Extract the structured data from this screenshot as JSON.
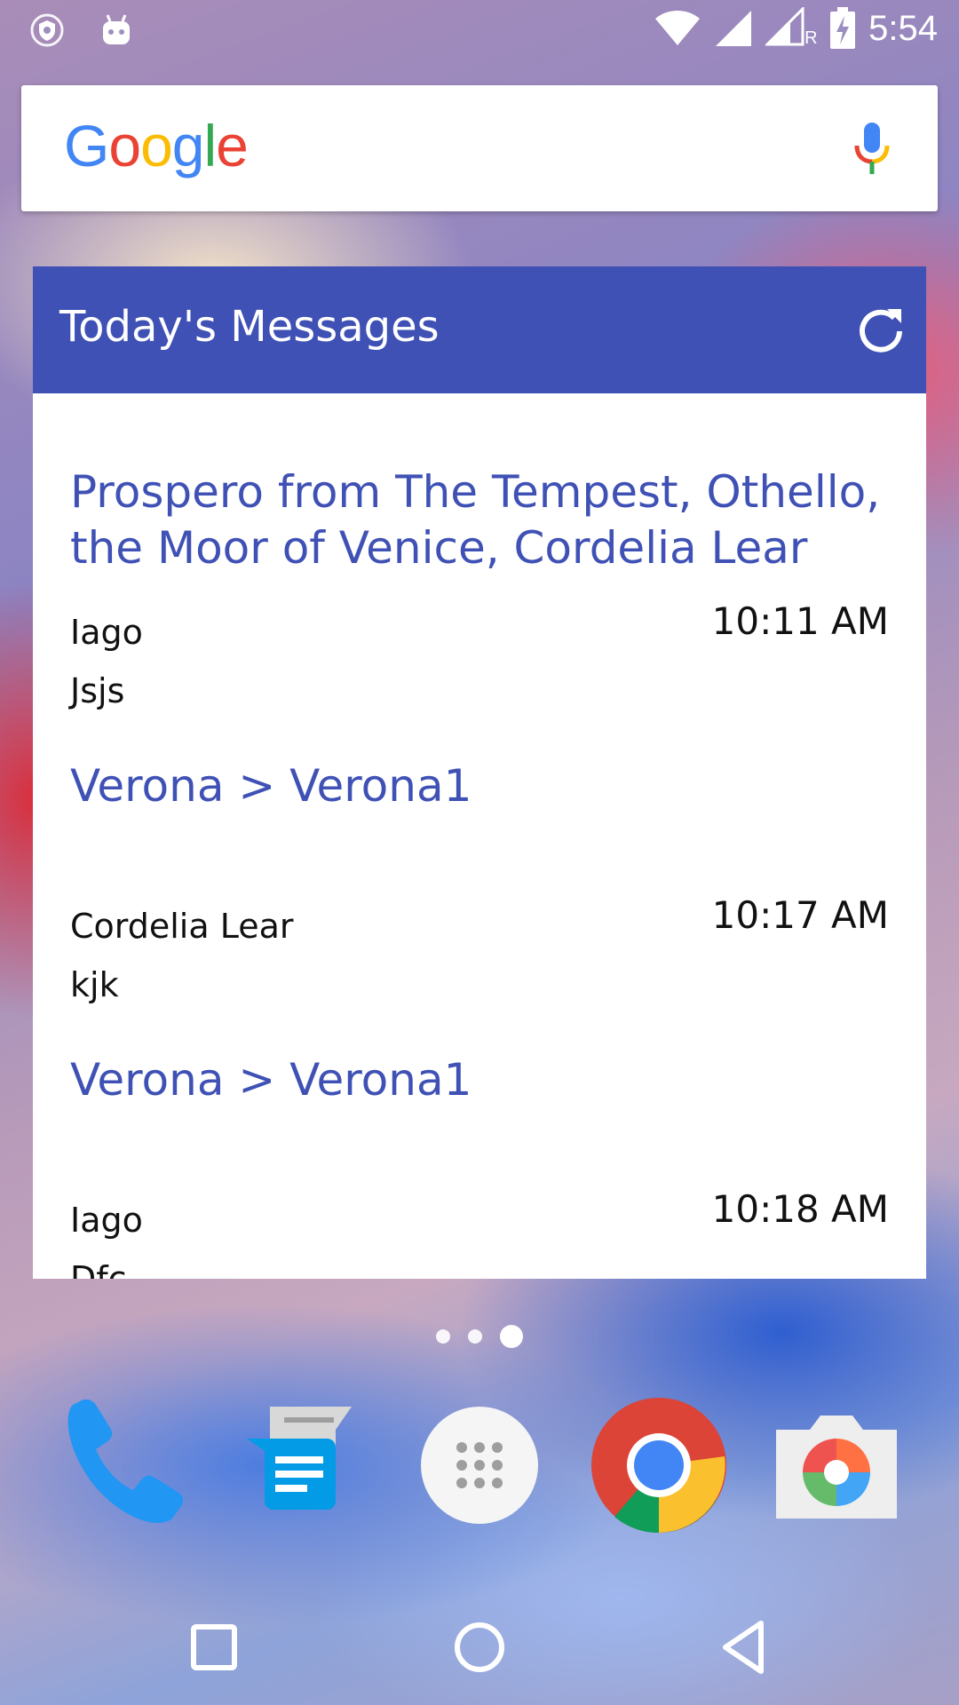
{
  "status_bar": {
    "time": "5:54",
    "icons": [
      "vpn-shield-icon",
      "android-icon",
      "wifi-icon",
      "signal-icon",
      "signal-roaming-icon",
      "battery-charging-icon"
    ],
    "roaming_label": "R"
  },
  "search_bar": {
    "logo_letters": [
      "G",
      "o",
      "o",
      "g",
      "l",
      "e"
    ],
    "logo_colors": [
      "#4285F4",
      "#EA4335",
      "#FBBC05",
      "#4285F4",
      "#34A853",
      "#EA4335"
    ],
    "icon": "mic-icon"
  },
  "widget": {
    "title": "Today's Messages",
    "header_color": "#3f51b5",
    "refresh_icon": "refresh-icon",
    "messages": [
      {
        "title": "Prospero from The Tempest, Othello, the Moor of Venice, Cordelia Lear",
        "sender": "Iago",
        "body": "Jsjs",
        "time": "10:11 AM"
      },
      {
        "title": "Verona > Verona1",
        "sender": "Cordelia Lear",
        "body": "kjk",
        "time": "10:17 AM"
      },
      {
        "title": "Verona > Verona1",
        "sender": "Iago",
        "body": "Dfc",
        "time": "10:18 AM"
      }
    ]
  },
  "page_indicator": {
    "pages": 3,
    "active_index": 2
  },
  "dock": {
    "apps": [
      "phone-app-icon",
      "messages-app-icon",
      "app-drawer-icon",
      "chrome-app-icon",
      "camera-app-icon"
    ]
  },
  "nav_bar": {
    "buttons": [
      "recents-button",
      "home-button",
      "back-button"
    ]
  }
}
